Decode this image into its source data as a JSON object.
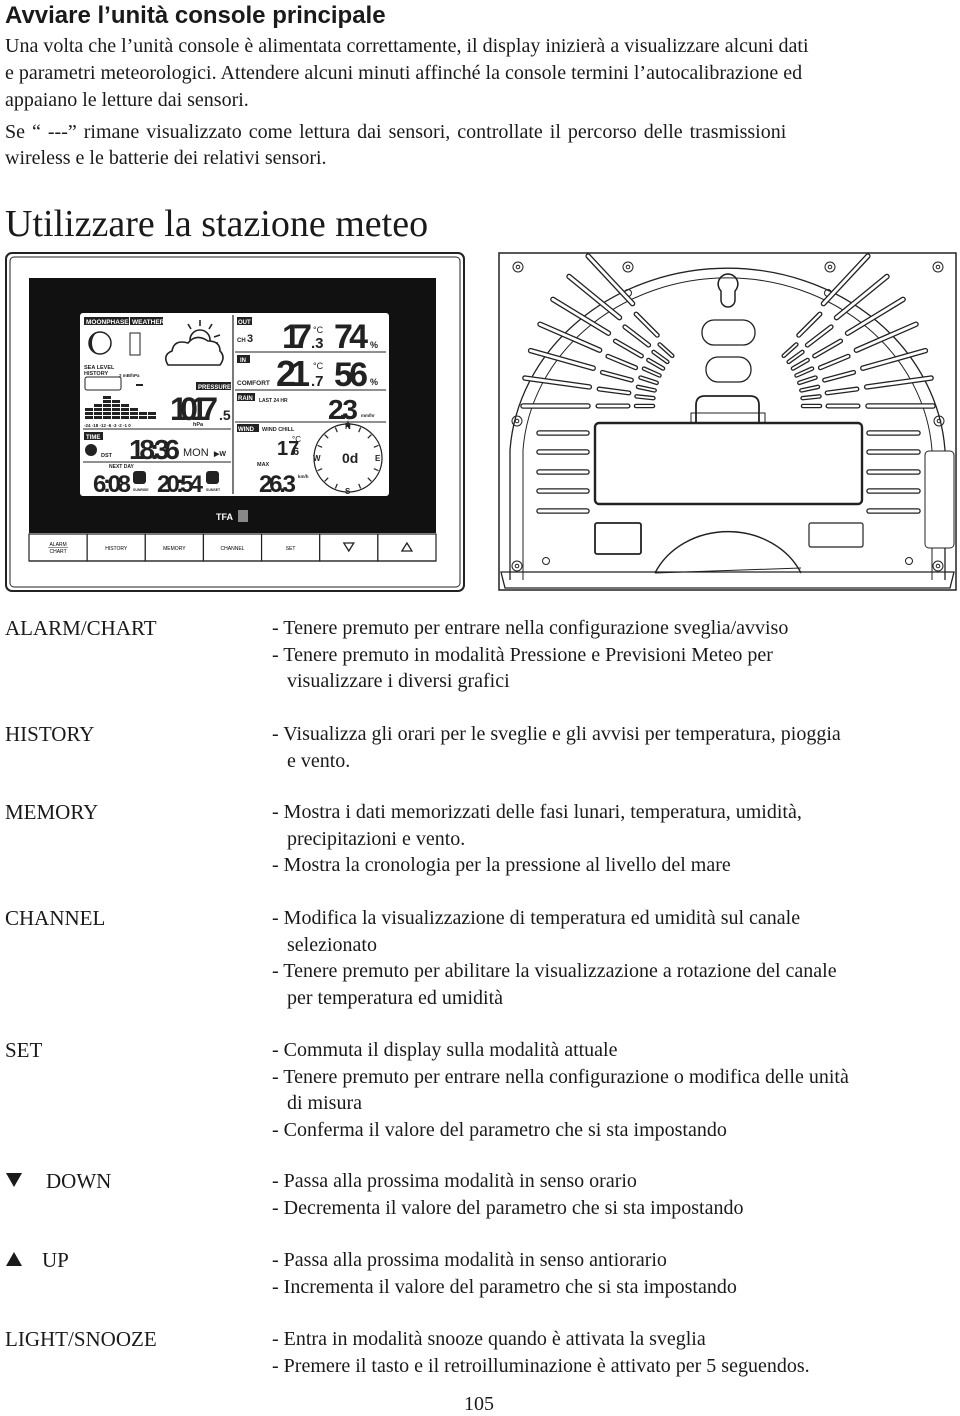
{
  "section1": {
    "title": "Avviare l’unità console principale",
    "lines": [
      "Una volta che l’unità console è alimentata correttamente, il display inizierà a visualizzare alcuni dati",
      "e parametri meteorologici. Attendere alcuni minuti affinché la console termini l’autocalibrazione ed",
      "appaiano le letture dai sensori.",
      "Se “ ---”  rimane visualizzato come lettura dai sensori, controllate il percorso delle trasmissioni",
      "wireless e le batterie dei relativi sensori."
    ]
  },
  "section2": {
    "title": "Utilizzare la stazione meteo"
  },
  "device": {
    "brand": "TFA",
    "buttons": [
      "ALARM",
      "CHART",
      "HISTORY",
      "MEMORY",
      "CHANNEL",
      "SET"
    ],
    "lcd": {
      "moonphase": "MOONPHASE",
      "weather": "WEATHER",
      "sea_level": "SEA LEVEL",
      "history": "HISTORY",
      "scale": "2 mB/hPa",
      "pressure_label": "PRESSURE",
      "pressure": "1017",
      "pressure_dec": ".5",
      "pressure_unit": "hPa",
      "bar_ticks": "-24 -18 -12 -6 -3 -2 -1 0",
      "time_label": "TIME",
      "dst": "DST",
      "time": "18:36",
      "day": "MON",
      "w": "▶W",
      "next_day": "NEXT DAY",
      "sunrise_time": "6:08",
      "sunrise": "SUNRISE",
      "sunset_time": "20:54",
      "sunset": "SUNSET",
      "out": "OUT",
      "ch": "CH",
      "ch_num": "3",
      "out_temp": "17",
      "out_temp_dec": ".3",
      "out_hum": "74",
      "in": "IN",
      "comfort": "COMFORT",
      "in_temp": "21",
      "in_temp_dec": ".7",
      "in_hum": "56",
      "deg_c": "°C",
      "pct": "%",
      "rain": "RAIN",
      "last24": "LAST 24 HR",
      "rain_val": "2.3",
      "rain_unit": "mm/hr",
      "wind": "WIND",
      "wind_chill": "WIND CHILL",
      "chill_temp": "17",
      "chill_dec": ".6",
      "max": "MAX",
      "max_val": "26.3",
      "wind_unit": "km/h",
      "n": "N",
      "e": "E",
      "s": "S",
      "w_dir": "W",
      "dir_val": "0d"
    }
  },
  "functions": [
    {
      "label": "ALARM/CHART",
      "lines": [
        {
          "t": "- Tenere premuto per entrare nella configurazione sveglia/avviso"
        },
        {
          "t": "- Tenere premuto in modalità Pressione e Previsioni Meteo per"
        },
        {
          "t": "visualizzare i diversi grafici",
          "c": true
        }
      ]
    },
    {
      "label": "HISTORY",
      "lines": [
        {
          "t": "- Visualizza gli orari per le sveglie e gli avvisi per temperatura, pioggia"
        },
        {
          "t": "e vento.",
          "c": true
        }
      ]
    },
    {
      "label": "MEMORY",
      "lines": [
        {
          "t": "- Mostra i dati memorizzati delle fasi lunari, temperatura, umidità,"
        },
        {
          "t": "precipitazioni e vento.",
          "c": true
        },
        {
          "t": "- Mostra la cronologia per la pressione al livello del mare"
        }
      ]
    },
    {
      "label": "CHANNEL",
      "lines": [
        {
          "t": "- Modifica la visualizzazione di temperatura ed umidità sul canale"
        },
        {
          "t": "selezionato",
          "c": true
        },
        {
          "t": "- Tenere premuto per abilitare la visualizzazione a rotazione del canale"
        },
        {
          "t": "per temperatura ed umidità",
          "c": true
        }
      ]
    },
    {
      "label": "SET",
      "lines": [
        {
          "t": "- Commuta il display sulla modalità attuale"
        },
        {
          "t": "- Tenere premuto per entrare nella configurazione o modifica delle unità"
        },
        {
          "t": "di misura",
          "c": true
        },
        {
          "t": "- Conferma il valore del parametro che si sta impostando"
        }
      ]
    },
    {
      "label": "DOWN",
      "icon": "triangle-down",
      "lines": [
        {
          "t": "- Passa alla prossima modalità in senso orario"
        },
        {
          "t": "- Decrementa il valore del parametro che si sta impostando"
        }
      ]
    },
    {
      "label": "UP",
      "icon": "triangle-up",
      "lines": [
        {
          "t": "- Passa alla prossima modalità in senso antiorario"
        },
        {
          "t": "- Incrementa il valore del parametro che si sta impostando"
        }
      ]
    },
    {
      "label": "LIGHT/SNOOZE",
      "lines": [
        {
          "t": "- Entra in modalità snooze quando è attivata la sveglia"
        },
        {
          "t": "- Premere il tasto e il retroilluminazione è attivato per 5 seguendos."
        }
      ]
    }
  ],
  "page_number": "105"
}
